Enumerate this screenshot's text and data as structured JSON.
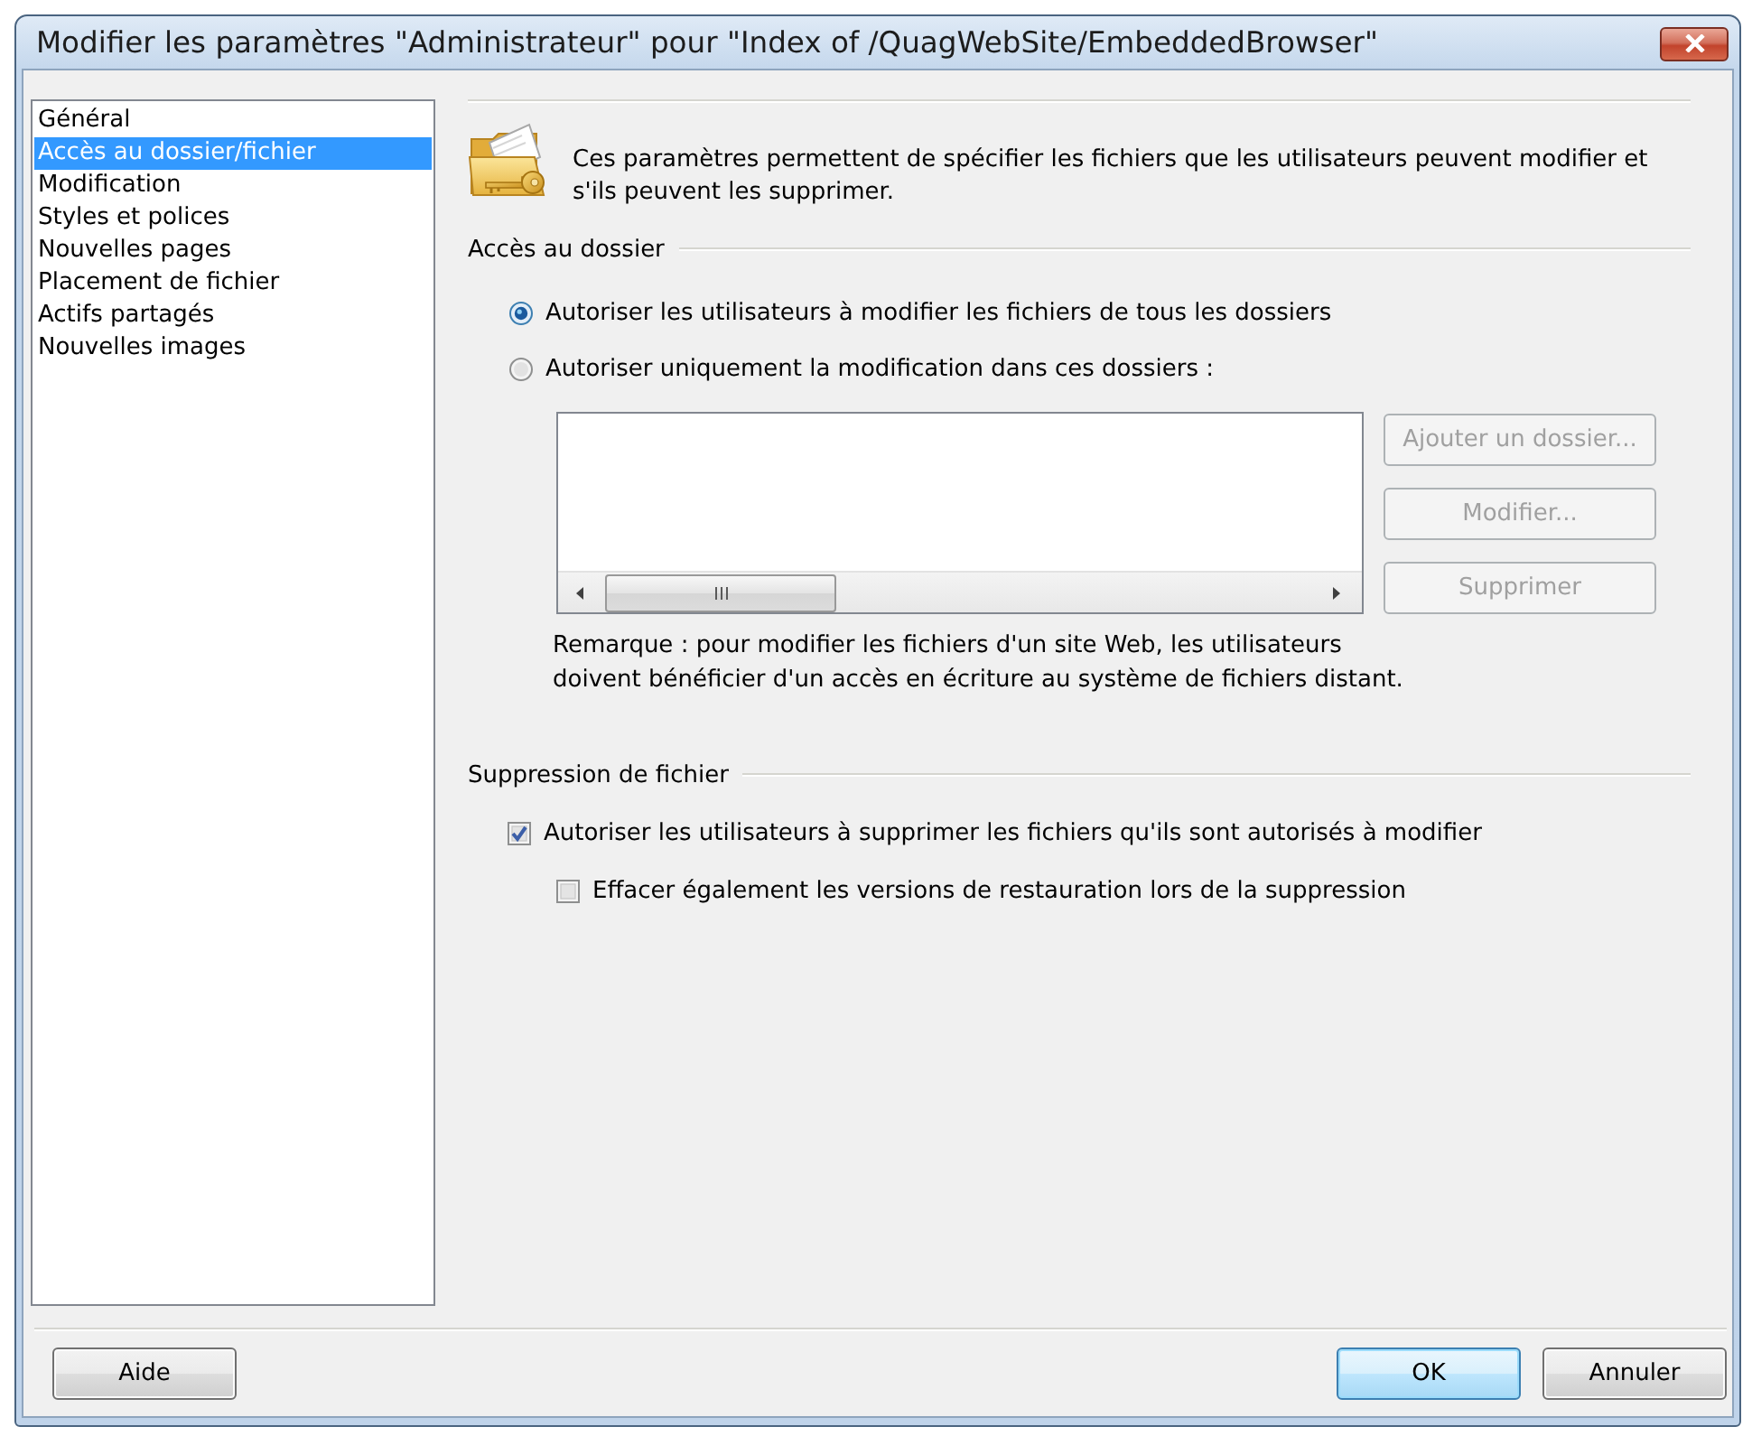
{
  "window": {
    "title": "Modifier les paramètres \"Administrateur\" pour \"Index of /QuagWebSite/EmbeddedBrowser\""
  },
  "sidebar": {
    "items": [
      {
        "label": "Général",
        "selected": false
      },
      {
        "label": "Accès au dossier/fichier",
        "selected": true
      },
      {
        "label": "Modification",
        "selected": false
      },
      {
        "label": "Styles et polices",
        "selected": false
      },
      {
        "label": "Nouvelles pages",
        "selected": false
      },
      {
        "label": "Placement de fichier",
        "selected": false
      },
      {
        "label": "Actifs partagés",
        "selected": false
      },
      {
        "label": "Nouvelles images",
        "selected": false
      }
    ]
  },
  "intro": {
    "text": "Ces paramètres permettent de spécifier les fichiers que les utilisateurs peuvent modifier et s'ils peuvent les supprimer."
  },
  "folder_access": {
    "title": "Accès au dossier",
    "options": [
      {
        "label": "Autoriser les utilisateurs à modifier les fichiers de tous les dossiers",
        "selected": true
      },
      {
        "label": "Autoriser uniquement la modification dans ces dossiers :",
        "selected": false
      }
    ],
    "folder_buttons": [
      {
        "label": "Ajouter un dossier...",
        "disabled": true
      },
      {
        "label": "Modifier...",
        "disabled": true
      },
      {
        "label": "Supprimer",
        "disabled": true
      }
    ],
    "note": "Remarque : pour modifier les fichiers d'un site Web, les utilisateurs doivent bénéficier d'un accès en écriture au système de fichiers distant."
  },
  "file_deletion": {
    "title": "Suppression de fichier",
    "options": [
      {
        "label": "Autoriser les utilisateurs à supprimer les fichiers qu'ils sont autorisés à modifier",
        "checked": true,
        "children": [
          {
            "label": "Effacer également les versions de restauration lors de la suppression",
            "checked": false
          }
        ]
      }
    ]
  },
  "footer": {
    "left_buttons": [
      {
        "label": "Aide",
        "default": false
      }
    ],
    "right_buttons": [
      {
        "label": "OK",
        "default": true
      },
      {
        "label": "Annuler",
        "default": false
      }
    ]
  }
}
